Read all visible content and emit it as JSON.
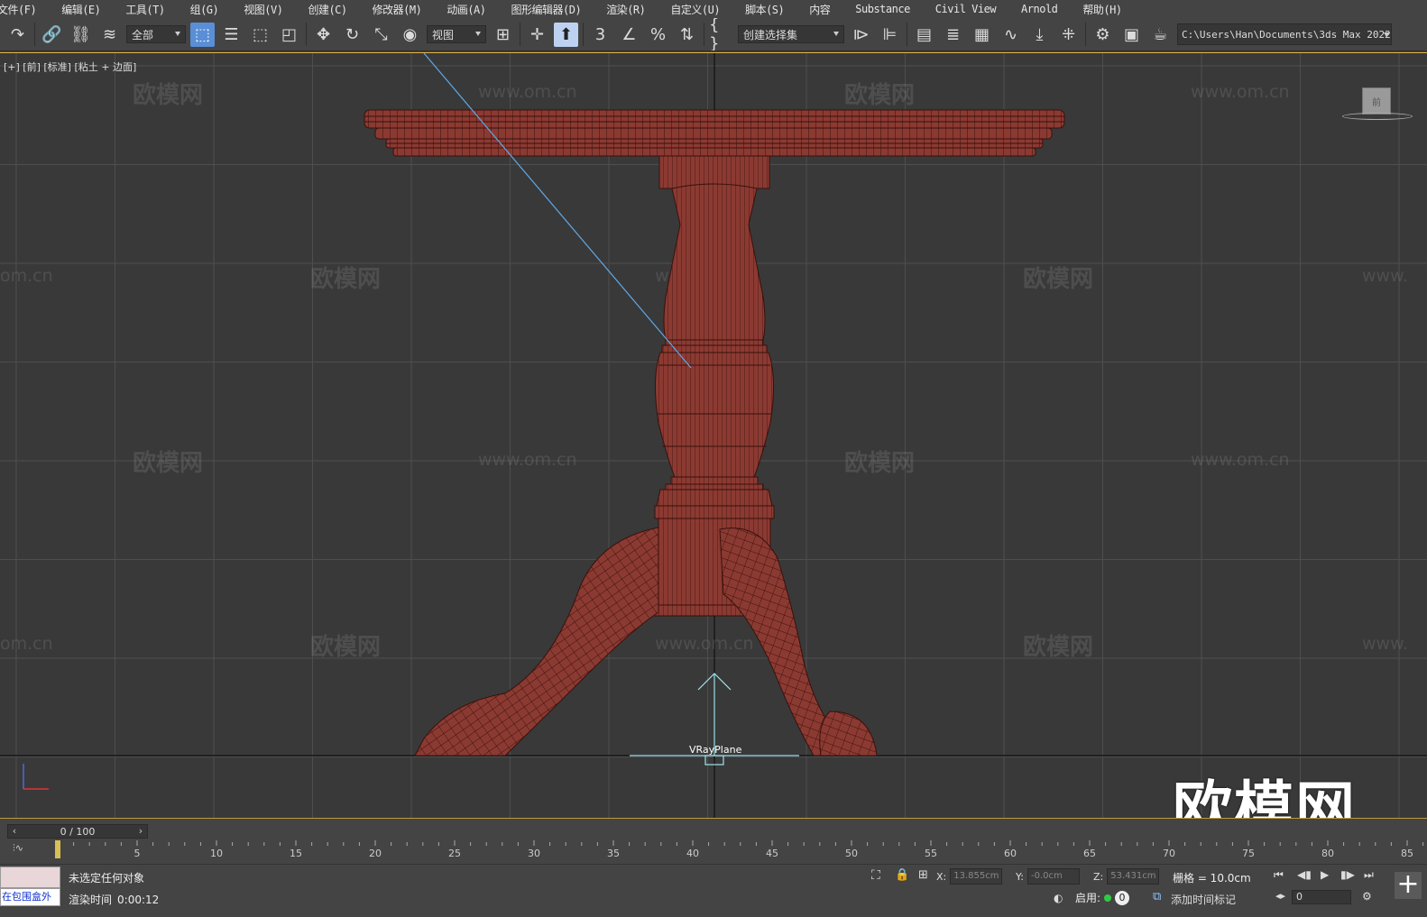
{
  "menu": [
    "文件(F)",
    "编辑(E)",
    "工具(T)",
    "组(G)",
    "视图(V)",
    "创建(C)",
    "修改器(M)",
    "动画(A)",
    "图形编辑器(D)",
    "渲染(R)",
    "自定义(U)",
    "脚本(S)",
    "内容",
    "Substance",
    "Civil View",
    "Arnold",
    "帮助(H)"
  ],
  "toolbar": {
    "selection_filter": "全部",
    "ref_coord": "视图",
    "named_selection": "创建选择集",
    "path": "C:\\Users\\Han\\Documents\\3ds Max 2022",
    "snap_label": "3"
  },
  "viewport": {
    "label": "[+] [前] [标准] [粘土 + 边面]",
    "object_label": "VRayPlane",
    "viewcube_label": "前",
    "watermark_cn": "欧模网",
    "watermark_url": "www.om.cn",
    "watermark_url_partial": "om.cn",
    "watermark_url_partial2": "www.",
    "brand_watermark": "欧模网",
    "colors": {
      "model": "#8b3a32",
      "wire": "#3a100c",
      "background": "#393939",
      "grid": "#4e4e4e"
    }
  },
  "timeline": {
    "slider_text": "0 / 100",
    "ticks": [
      "0",
      "5",
      "10",
      "15",
      "20",
      "25",
      "30",
      "35",
      "40",
      "45",
      "50",
      "55",
      "60",
      "65",
      "70",
      "75",
      "80",
      "85"
    ]
  },
  "status": {
    "maxscript_text": "在包围盒外",
    "selection": "未选定任何对象",
    "render_time_label": "渲染时间",
    "render_time": "0:00:12",
    "x_label": "X:",
    "x_value": "13.855cm",
    "y_label": "Y:",
    "y_value": "-0.0cm",
    "z_label": "Z:",
    "z_value": "53.431cm",
    "grid": "栅格 = 10.0cm",
    "enable_label": "启用:",
    "enable_value": "0",
    "add_time_tag": "添加时间标记",
    "frame_value": "0"
  }
}
